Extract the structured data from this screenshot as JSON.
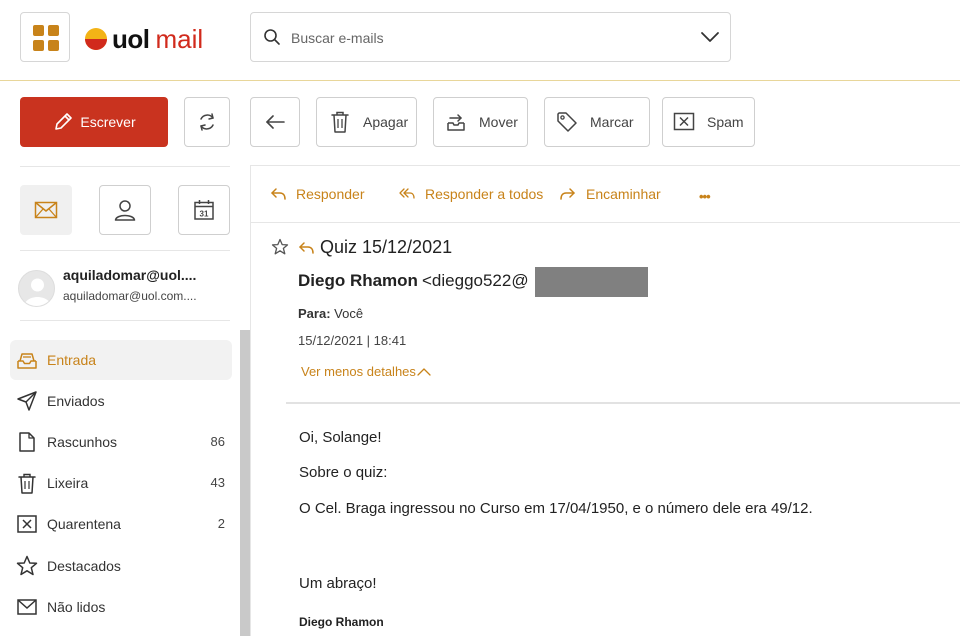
{
  "header": {
    "logo_uol": "uol",
    "logo_mail": "mail",
    "search_placeholder": "Buscar e-mails"
  },
  "toolbar": {
    "write_label": "Escrever",
    "delete_label": "Apagar",
    "move_label": "Mover",
    "tag_label": "Marcar",
    "spam_label": "Spam"
  },
  "account": {
    "name": "aquiladomar@uol....",
    "email": "aquiladomar@uol.com...."
  },
  "folders": [
    {
      "label": "Entrada",
      "count": "",
      "icon": "inbox-icon"
    },
    {
      "label": "Enviados",
      "count": "",
      "icon": "send-icon"
    },
    {
      "label": "Rascunhos",
      "count": "86",
      "icon": "draft-icon"
    },
    {
      "label": "Lixeira",
      "count": "43",
      "icon": "trash-icon"
    },
    {
      "label": "Quarentena",
      "count": "2",
      "icon": "quarantine-icon"
    },
    {
      "label": "Destacados",
      "count": "",
      "icon": "star-icon"
    },
    {
      "label": "Não lidos",
      "count": "",
      "icon": "unread-icon"
    }
  ],
  "actions": {
    "reply": "Responder",
    "reply_all": "Responder a todos",
    "forward": "Encaminhar",
    "more": "•••"
  },
  "message": {
    "subject": "Quiz 15/12/2021",
    "sender_name": "Diego Rhamon",
    "sender_email": "<dieggo522@",
    "to_label": "Para:",
    "to_value": "Você",
    "date": "15/12/2021 | 18:41",
    "details_toggle": "Ver menos detalhes",
    "body": [
      "Oi, Solange!",
      "Sobre o quiz:",
      "O Cel. Braga ingressou no Curso em 17/04/1950, e o número dele era 49/12.",
      "Um abraço!"
    ],
    "signature": "Diego Rhamon"
  },
  "colors": {
    "accent": "#c8831a",
    "brand_red": "#c9331f",
    "header_border": "#e8d69a"
  }
}
